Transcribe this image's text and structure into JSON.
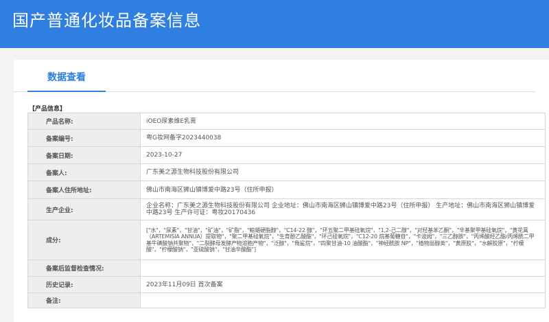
{
  "header": {
    "title": "国产普通化妆品备案信息"
  },
  "tabs": [
    {
      "label": "数据查看"
    }
  ],
  "section_label": "【产品信息】",
  "fields": {
    "product_name": {
      "label": "产品名称:",
      "value": "iOEO尿素维E乳膏"
    },
    "record_number": {
      "label": "备案编号:",
      "value": "粤G妆网备字2023440038"
    },
    "record_date": {
      "label": "备案日期:",
      "value": "2023-10-27"
    },
    "registrant": {
      "label": "备案人:",
      "value": "广东美之源生物科技股份有限公司"
    },
    "registrant_address": {
      "label": "备案人住所地址:",
      "value": "佛山市南海区狮山镇博爱中路23号（住所申报）"
    },
    "manufacturer": {
      "label": "生产企业:",
      "value": "企业名称：广东美之源生物科技股份有限公司 企业地址：佛山市南海区狮山镇博爱中路23号（住所申报） 生产地址：佛山市南海区狮山镇博爱中路23号 生产许可证：粤妆20170436"
    },
    "ingredients": {
      "label": "成分:",
      "value": "[\"水\"，\"尿素\"，\"甘油\"，\"矿油\"，\"矿脂\"，\"鲸蜡硬脂醇\"，\"C14-22 醇\"，\"环五聚二甲基硅氧烷\"，\"1,2-己二醇\"，\"对羟基苯乙酮\"，\"辛基聚甲基硅氧烷\"，\"黄花蒿（ARTEMISIA ANNUA）提取物\"，\"聚二甲基硅氧烷\"，\"生育酚乙酸酯\"，\"环己硅氧烷\"，\"C12-20 烷基葡糖苷\"，\"卡波姆\"，\"三乙醇胺\"，\"丙烯酸羟乙酯/丙烯酰二甲基牛磺酸钠共聚物\"，\"二裂酵母发酵产物溶胞产物\"，\"泛醇\"，\"角鲨烷\"，\"四聚甘油-10 油酸酯\"，\"神经酰胺 NP\"，\"植物甾醇类\"，\"黄原胶\"，\"水解胶原\"，\"柠檬酸\"，\"柠檬酸钠\"，\"亚硫酸钠\"，\"甘油辛酸酯\"]"
    },
    "supervision": {
      "label": "备案后监督检查情况:",
      "value": ""
    },
    "history": {
      "label": "历史记录:",
      "value": "2023年11月09日 首次备案"
    },
    "remarks": {
      "label": "备注:",
      "value": ""
    }
  }
}
